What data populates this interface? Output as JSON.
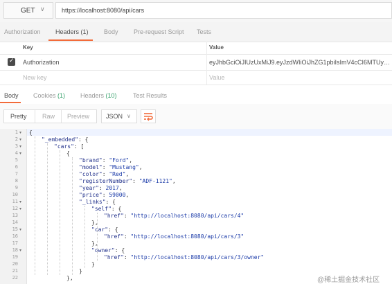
{
  "request": {
    "method": "GET",
    "url": "https://localhost:8080/api/cars"
  },
  "request_tabs": [
    {
      "label": "Authorization",
      "active": false
    },
    {
      "label": "Headers (1)",
      "active": true
    },
    {
      "label": "Body",
      "active": false
    },
    {
      "label": "Pre-request Script",
      "active": false
    },
    {
      "label": "Tests",
      "active": false
    }
  ],
  "headers_table": {
    "col_key": "Key",
    "col_value": "Value",
    "rows": [
      {
        "checked": true,
        "key": "Authorization",
        "value": "eyJhbGciOiJIUzUxMiJ9.eyJzdWIiOiJhZG1pbiIsImV4cCI6MTUyNTMz..."
      }
    ],
    "new_key_placeholder": "New key",
    "new_value_placeholder": "Value"
  },
  "response_tabs": [
    {
      "label": "Body",
      "count": "",
      "active": true
    },
    {
      "label": "Cookies",
      "count": "(1)",
      "active": false
    },
    {
      "label": "Headers",
      "count": "(10)",
      "active": false
    },
    {
      "label": "Test Results",
      "count": "",
      "active": false
    }
  ],
  "view_modes": [
    "Pretty",
    "Raw",
    "Preview"
  ],
  "active_view": "Pretty",
  "format": "JSON",
  "icons": {
    "method_caret": "chevron-down-icon",
    "format_caret": "chevron-down-icon",
    "wrap": "wrap-lines-icon"
  },
  "colors": {
    "accent": "#f26b3a",
    "count_green": "#3aa36e",
    "json_string": "#1a3aa8"
  },
  "code_lines": [
    {
      "n": "1",
      "fold": true,
      "tokens": [
        [
          "p",
          "{"
        ]
      ]
    },
    {
      "n": "2",
      "fold": true,
      "tokens": [
        [
          "k",
          "\"_embedded\""
        ],
        [
          "p",
          ": {"
        ]
      ]
    },
    {
      "n": "3",
      "fold": true,
      "tokens": [
        [
          "k",
          "\"cars\""
        ],
        [
          "p",
          ": ["
        ]
      ]
    },
    {
      "n": "4",
      "fold": true,
      "tokens": [
        [
          "p",
          "{"
        ]
      ]
    },
    {
      "n": "5",
      "fold": false,
      "tokens": [
        [
          "k",
          "\"brand\""
        ],
        [
          "p",
          ": "
        ],
        [
          "s",
          "\"Ford\""
        ],
        [
          "p",
          ","
        ]
      ]
    },
    {
      "n": "6",
      "fold": false,
      "tokens": [
        [
          "k",
          "\"model\""
        ],
        [
          "p",
          ": "
        ],
        [
          "s",
          "\"Mustang\""
        ],
        [
          "p",
          ","
        ]
      ]
    },
    {
      "n": "7",
      "fold": false,
      "tokens": [
        [
          "k",
          "\"color\""
        ],
        [
          "p",
          ": "
        ],
        [
          "s",
          "\"Red\""
        ],
        [
          "p",
          ","
        ]
      ]
    },
    {
      "n": "8",
      "fold": false,
      "tokens": [
        [
          "k",
          "\"registerNumber\""
        ],
        [
          "p",
          ": "
        ],
        [
          "s",
          "\"ADF-1121\""
        ],
        [
          "p",
          ","
        ]
      ]
    },
    {
      "n": "9",
      "fold": false,
      "tokens": [
        [
          "k",
          "\"year\""
        ],
        [
          "p",
          ": "
        ],
        [
          "n",
          "2017"
        ],
        [
          "p",
          ","
        ]
      ]
    },
    {
      "n": "10",
      "fold": false,
      "tokens": [
        [
          "k",
          "\"price\""
        ],
        [
          "p",
          ": "
        ],
        [
          "n",
          "59000"
        ],
        [
          "p",
          ","
        ]
      ]
    },
    {
      "n": "11",
      "fold": true,
      "tokens": [
        [
          "k",
          "\"_links\""
        ],
        [
          "p",
          ": {"
        ]
      ]
    },
    {
      "n": "12",
      "fold": true,
      "tokens": [
        [
          "k",
          "\"self\""
        ],
        [
          "p",
          ": {"
        ]
      ]
    },
    {
      "n": "13",
      "fold": false,
      "tokens": [
        [
          "k",
          "\"href\""
        ],
        [
          "p",
          ": "
        ],
        [
          "s",
          "\"http://localhost:8080/api/cars/4\""
        ]
      ]
    },
    {
      "n": "14",
      "fold": false,
      "tokens": [
        [
          "p",
          "},"
        ]
      ]
    },
    {
      "n": "15",
      "fold": true,
      "tokens": [
        [
          "k",
          "\"car\""
        ],
        [
          "p",
          ": {"
        ]
      ]
    },
    {
      "n": "16",
      "fold": false,
      "tokens": [
        [
          "k",
          "\"href\""
        ],
        [
          "p",
          ": "
        ],
        [
          "s",
          "\"http://localhost:8080/api/cars/3\""
        ]
      ]
    },
    {
      "n": "17",
      "fold": false,
      "tokens": [
        [
          "p",
          "},"
        ]
      ]
    },
    {
      "n": "18",
      "fold": true,
      "tokens": [
        [
          "k",
          "\"owner\""
        ],
        [
          "p",
          ": {"
        ]
      ]
    },
    {
      "n": "19",
      "fold": false,
      "tokens": [
        [
          "k",
          "\"href\""
        ],
        [
          "p",
          ": "
        ],
        [
          "s",
          "\"http://localhost:8080/api/cars/3/owner\""
        ]
      ]
    },
    {
      "n": "20",
      "fold": false,
      "tokens": [
        [
          "p",
          "}"
        ]
      ]
    },
    {
      "n": "21",
      "fold": false,
      "tokens": [
        [
          "p",
          "}"
        ]
      ]
    },
    {
      "n": "22",
      "fold": false,
      "tokens": [
        [
          "p",
          "},"
        ]
      ]
    }
  ],
  "watermark": "@稀土掘金技术社区"
}
